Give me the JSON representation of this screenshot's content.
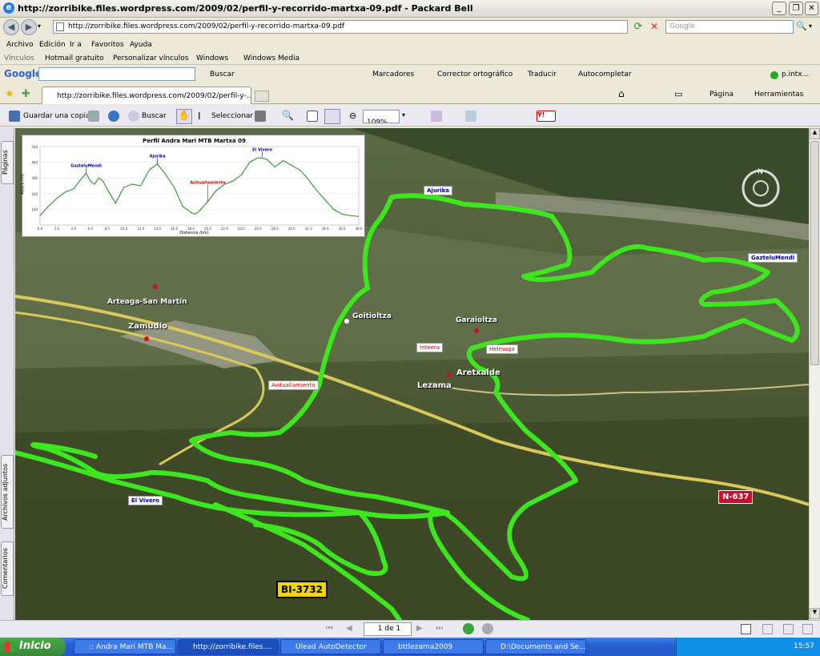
{
  "window": {
    "title": "http://zorribike.files.wordpress.com/2009/02/perfil-y-recorrido-martxa-09.pdf - Packard Bell"
  },
  "address": {
    "url": "http://zorribike.files.wordpress.com/2009/02/perfil-y-recorrido-martxa-09.pdf",
    "search_placeholder": "Google"
  },
  "menu": {
    "items": [
      "Archivo",
      "Edición",
      "Ir a",
      "Favoritos",
      "Ayuda"
    ]
  },
  "links": {
    "label": "Vínculos",
    "items": [
      "Hotmail gratuito",
      "Personalizar vínculos",
      "Windows",
      "Windows Media"
    ]
  },
  "google_bar": {
    "logo": "Google",
    "search": "Buscar",
    "bookmarks": "Marcadores",
    "spell": "Corrector ortográfico",
    "translate": "Traducir",
    "autofill": "Autocompletar",
    "user": "p.intx..."
  },
  "tab": {
    "label": "http://zorribike.files.wordpress.com/2009/02/perfil-y-..."
  },
  "ie_tools": {
    "page": "Página",
    "tools": "Herramientas"
  },
  "pdf_toolbar": {
    "save": "Guardar una copia",
    "search": "Buscar",
    "select": "Seleccionar",
    "zoom": "109%"
  },
  "sidebar": {
    "pages": "Páginas",
    "attachments": "Archivos adjuntos",
    "comments": "Comentarios"
  },
  "profile_chart": {
    "title": "Perfil Andra Mari MTB Martxa 09",
    "xlabel": "Distancia (km)",
    "ylabel": "Altura (m)",
    "peaks": [
      "GazteluMendi",
      "Ajurika",
      "El Vivero"
    ],
    "dip": "Avituallamiento"
  },
  "chart_data": {
    "type": "line",
    "title": "Perfil Andra Mari MTB Martxa 09",
    "xlabel": "Distancia (km)",
    "ylabel": "Altura (m)",
    "ylim": [
      0,
      500
    ],
    "xlim": [
      0,
      38
    ],
    "x_ticks": [
      "0.0",
      "2.0",
      "4.0",
      "6.0",
      "8.0",
      "10.0",
      "12.0",
      "14.0",
      "16.0",
      "18.0",
      "20.0",
      "22.0",
      "24.0",
      "26.0",
      "28.0",
      "30.0",
      "32.0",
      "34.0",
      "36.0",
      "38.0"
    ],
    "y_ticks": [
      "100",
      "200",
      "300",
      "400",
      "500"
    ],
    "x": [
      0,
      1,
      2,
      3,
      4,
      5,
      5.5,
      6,
      6.5,
      7,
      7.5,
      8,
      9,
      10,
      11,
      12,
      13,
      14,
      15,
      16,
      17,
      18,
      18.5,
      19,
      20,
      21,
      22,
      23,
      24,
      25,
      26,
      27,
      28,
      29,
      30,
      31,
      32,
      33,
      34,
      35,
      36,
      37,
      38
    ],
    "y": [
      60,
      120,
      170,
      210,
      230,
      300,
      330,
      280,
      260,
      300,
      280,
      230,
      140,
      240,
      260,
      250,
      350,
      390,
      320,
      240,
      120,
      80,
      70,
      90,
      150,
      220,
      260,
      280,
      320,
      400,
      430,
      420,
      370,
      410,
      380,
      350,
      290,
      220,
      160,
      100,
      70,
      60,
      55
    ],
    "annotations": [
      {
        "text": "GazteluMendi",
        "x": 5.5
      },
      {
        "text": "Ajurika",
        "x": 14
      },
      {
        "text": "Avituallamiento",
        "x": 20
      },
      {
        "text": "El Vivero",
        "x": 26.5
      }
    ]
  },
  "map": {
    "labels": [
      "Arteaga-San Martín",
      "Zamudio",
      "Goitioltza",
      "Garaioltza",
      "Aretxalde",
      "Lezama"
    ],
    "white_labels": [
      "Ajurika",
      "GazteluMendi",
      "Avituallamiento",
      "Inteera",
      "Helmuga",
      "El Vivero"
    ],
    "road_signs": [
      "N-637",
      "BI-3732"
    ]
  },
  "status": {
    "page_input": "1 de 1"
  },
  "taskbar": {
    "start": "Inicio",
    "windows": [
      ":: Andra Mari MTB Ma...",
      "http://zorribike.files....",
      "Ulead AutoDetector",
      "bttlezama2009",
      "D:\\Documents and Se..."
    ],
    "clock": "15:57"
  }
}
